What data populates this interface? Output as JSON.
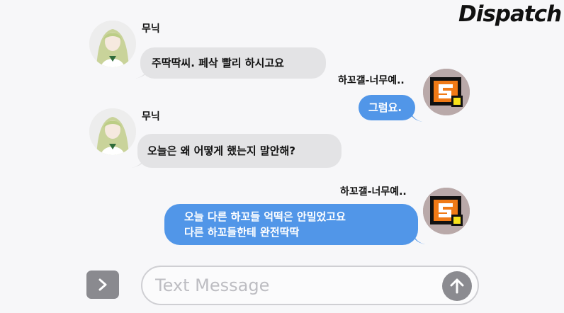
{
  "watermark": {
    "text": "Dispatch"
  },
  "messages": [
    {
      "sender": "무닉",
      "lines": [
        "주딱딱씨. 페삭 빨리 하시고요"
      ],
      "direction": "incoming",
      "avatar": "anime-girl-avatar"
    },
    {
      "sender": "하꼬갤-너무예..",
      "lines": [
        "그럼요."
      ],
      "direction": "outgoing",
      "avatar": "game-logo-avatar"
    },
    {
      "sender": "무닉",
      "lines": [
        "오늘은 왜 어떻게 했는지 말안해?"
      ],
      "direction": "incoming",
      "avatar": "anime-girl-avatar"
    },
    {
      "sender": "하꼬갤-너무예..",
      "lines": [
        "오늘 다른 하꼬들 억떡은 안밀었고요",
        "다른 하꼬들한테 완전딱딱"
      ],
      "direction": "outgoing",
      "avatar": "game-logo-avatar"
    }
  ],
  "composer": {
    "placeholder": "Text Message",
    "expand_icon": "chevron-right-icon",
    "send_icon": "arrow-up-icon"
  },
  "colors": {
    "outgoing_bubble": "#5196e8",
    "incoming_bubble": "#e3e3e5",
    "background": "#f7f7f9",
    "logo_orange": "#f07a16",
    "logo_yellow": "#f7e21a"
  }
}
